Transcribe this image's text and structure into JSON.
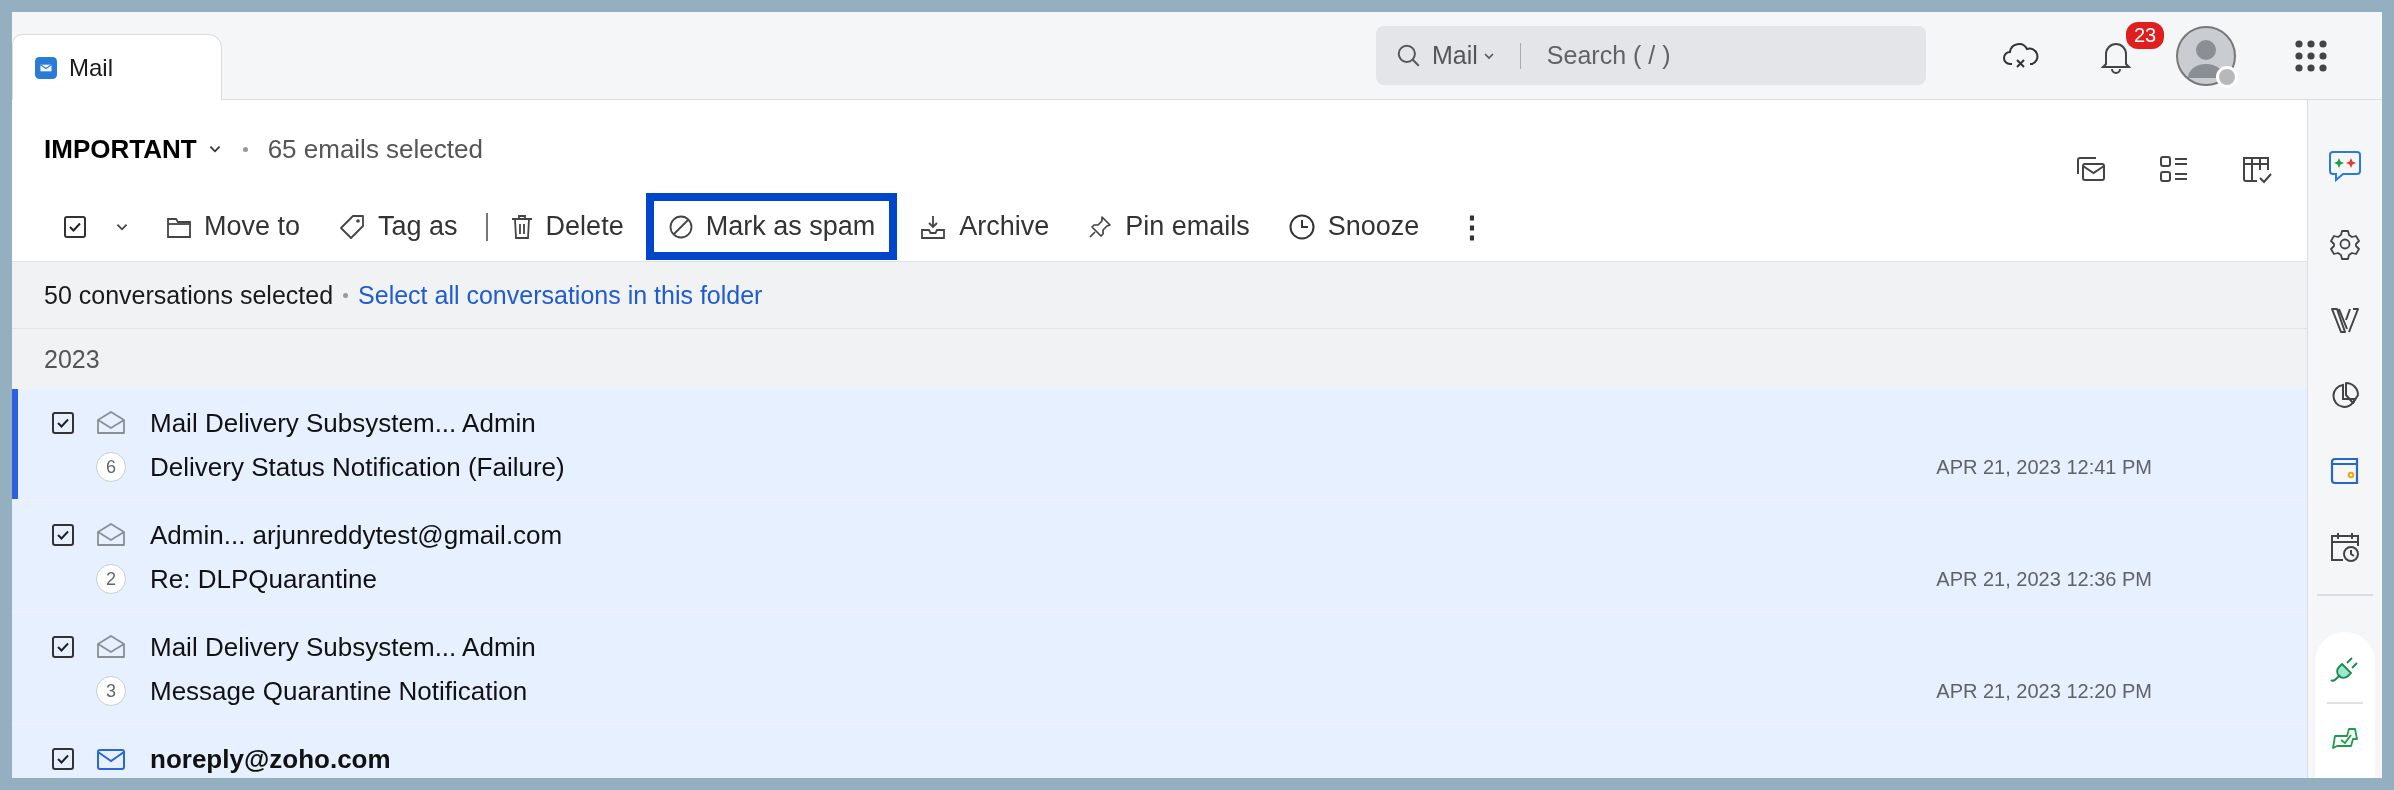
{
  "tab": {
    "label": "Mail"
  },
  "search": {
    "scope": "Mail",
    "placeholder": "Search ( / )"
  },
  "notifications": {
    "count": "23"
  },
  "folder": {
    "name": "IMPORTANT",
    "selection_note": "65 emails selected"
  },
  "toolbar": {
    "select_all_checked": true,
    "actions": [
      {
        "kind": "move",
        "label": "Move to",
        "highlighted": false,
        "separator_after": false
      },
      {
        "kind": "tag",
        "label": "Tag as",
        "highlighted": false,
        "separator_after": true
      },
      {
        "kind": "delete",
        "label": "Delete",
        "highlighted": false,
        "separator_after": false
      },
      {
        "kind": "spam",
        "label": "Mark as spam",
        "highlighted": true,
        "separator_after": false
      },
      {
        "kind": "archive",
        "label": "Archive",
        "highlighted": false,
        "separator_after": false
      },
      {
        "kind": "pin",
        "label": "Pin emails",
        "highlighted": false,
        "separator_after": false
      },
      {
        "kind": "snooze",
        "label": "Snooze",
        "highlighted": false,
        "separator_after": false
      },
      {
        "kind": "more",
        "label": "⋮",
        "highlighted": false,
        "separator_after": false
      }
    ]
  },
  "selection_bar": {
    "text": "50 conversations selected",
    "link": "Select all conversations in this folder"
  },
  "group": {
    "label": "2023"
  },
  "rows": [
    {
      "checked": true,
      "unread": false,
      "current": true,
      "from": "Mail Delivery Subsystem... Admin",
      "count": "6",
      "subject": "Delivery Status Notification (Failure)",
      "date": "APR 21, 2023 12:41 PM"
    },
    {
      "checked": true,
      "unread": false,
      "current": false,
      "from": "Admin... arjunreddytest@gmail.com",
      "count": "2",
      "subject": "Re: DLPQuarantine",
      "date": "APR 21, 2023 12:36 PM"
    },
    {
      "checked": true,
      "unread": false,
      "current": false,
      "from": "Mail Delivery Subsystem... Admin",
      "count": "3",
      "subject": "Message Quarantine Notification",
      "date": "APR 21, 2023 12:20 PM"
    },
    {
      "checked": true,
      "unread": true,
      "current": false,
      "from": "noreply@zoho.com"
    }
  ]
}
